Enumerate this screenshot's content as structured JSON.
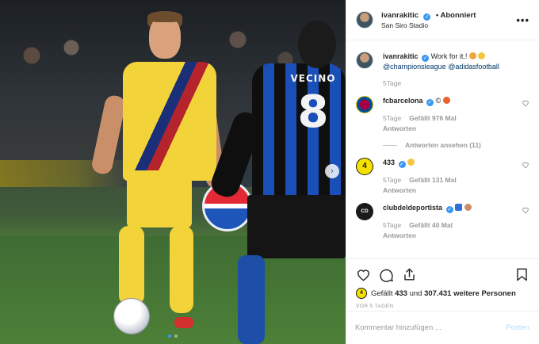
{
  "header": {
    "username": "ivanrakitic",
    "follow_status": "• Abonniert",
    "location": "San Siro Stadio",
    "more_icon": "more-options-icon"
  },
  "photo": {
    "jersey_name": "VECINO",
    "jersey_number": "8"
  },
  "caption": {
    "username": "ivanrakitic",
    "text": "Work for it.!",
    "mentions": [
      "@championsleague",
      "@adidasfootball"
    ],
    "time": "5Tage"
  },
  "comments": [
    {
      "username": "fcbarcelona",
      "text": "©",
      "time": "5Tage",
      "likes": "Gefällt 976 Mal",
      "reply": "Antworten",
      "thread": "Antworten ansehen (11)"
    },
    {
      "username": "433",
      "avatar_text": "4",
      "text": "",
      "time": "5Tage",
      "likes": "Gefällt 131 Mal",
      "reply": "Antworten"
    },
    {
      "username": "clubdeldeportista",
      "avatar_text": "CD",
      "text": "",
      "time": "5Tage",
      "likes": "Gefällt 40 Mal",
      "reply": "Antworten"
    }
  ],
  "likes_summary": {
    "prefix": "Gefällt",
    "count_a": "433",
    "middle": "und",
    "count_b": "307.431 weitere Personen"
  },
  "timestamp": "VOR 5 TAGEN",
  "comment_box": {
    "placeholder": "Kommentar hinzufügen ...",
    "post_label": "Posten"
  },
  "colors": {
    "accent": "#3897f0",
    "post_disabled": "#b2dffc"
  }
}
